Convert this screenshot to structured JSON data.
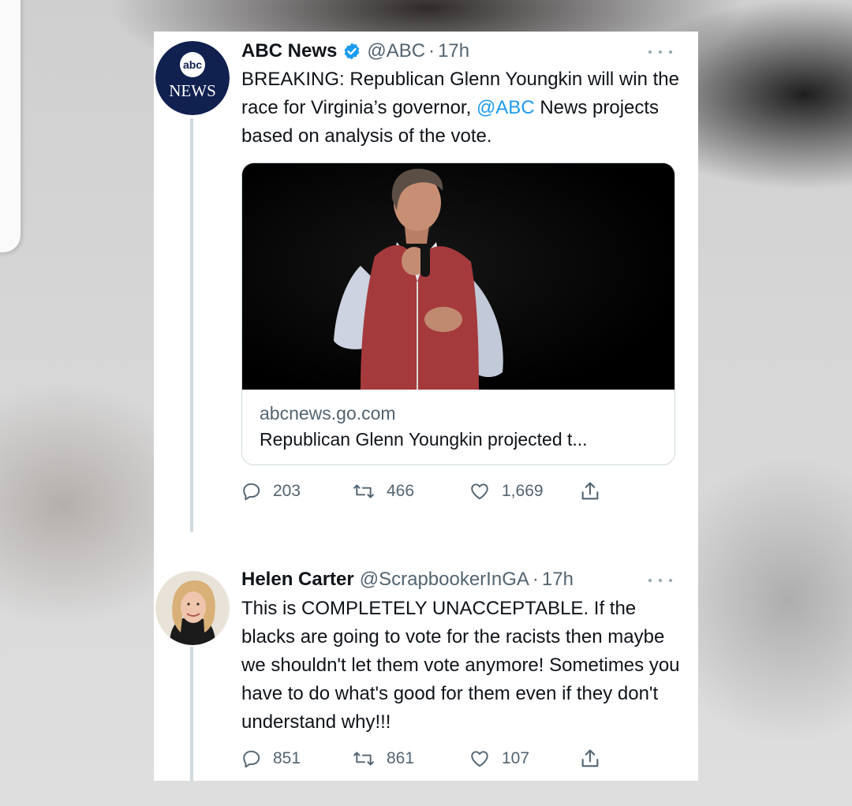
{
  "tweet": {
    "author_name": "ABC News",
    "handle": "@ABC",
    "separator": "·",
    "time": "17h",
    "text_before": "BREAKING: Republican Glenn Youngkin will win the race for Virginia’s governor, ",
    "mention": "@ABC",
    "text_after": " News projects based on analysis of the vote.",
    "avatar_line1": "abc",
    "avatar_line2": "NEWS",
    "card": {
      "domain": "abcnews.go.com",
      "title": "Republican Glenn Youngkin projected t..."
    },
    "stats": {
      "replies": "203",
      "retweets": "466",
      "likes": "1,669"
    }
  },
  "reply": {
    "author_name": "Helen Carter",
    "handle": "@ScrapbookerInGA",
    "separator": "·",
    "time": "17h",
    "text": "This is COMPLETELY UNACCEPTABLE. If the blacks are going to vote for the racists then maybe we shouldn't let them vote anymore! Sometimes you have to do what's good for them even if they don't understand why!!!",
    "stats": {
      "replies": "851",
      "retweets": "861",
      "likes": "107"
    }
  },
  "colors": {
    "link_blue": "#1d9bf0",
    "secondary_text": "#536471",
    "abc_navy": "#10204f"
  },
  "icons": [
    "verified-badge-icon",
    "more-icon",
    "reply-icon",
    "retweet-icon",
    "like-icon",
    "share-icon"
  ]
}
